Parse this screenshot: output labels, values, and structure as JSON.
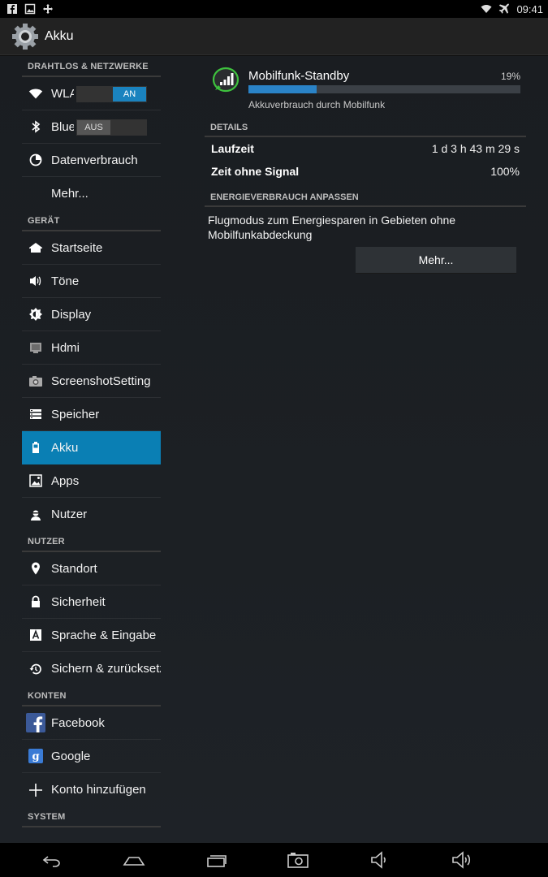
{
  "statusbar": {
    "left_icons": [
      "facebook-notification-icon",
      "image-notification-icon",
      "move-notification-icon"
    ],
    "right_icons": [
      "wifi-icon",
      "airplane-mode-icon"
    ],
    "time": "09:41"
  },
  "actionbar": {
    "title": "Akku",
    "icon": "settings-gear-icon"
  },
  "sidebar": {
    "sections": [
      {
        "header": "DRAHTLOS & NETZWERKE"
      },
      {
        "header": "GERÄT"
      },
      {
        "header": "NUTZER"
      },
      {
        "header": "KONTEN"
      },
      {
        "header": "SYSTEM"
      }
    ],
    "wifi": {
      "label": "WLAN",
      "toggle": "AN"
    },
    "bluetooth": {
      "label": "Bluetooth",
      "toggle": "AUS"
    },
    "items": {
      "data_usage": "Datenverbrauch",
      "more": "Mehr...",
      "home": "Startseite",
      "sounds": "Töne",
      "display": "Display",
      "hdmi": "Hdmi",
      "screenshot": "ScreenshotSetting",
      "storage": "Speicher",
      "battery": "Akku",
      "apps": "Apps",
      "users": "Nutzer",
      "location": "Standort",
      "security": "Sicherheit",
      "language": "Sprache & Eingabe",
      "backup": "Sichern & zurücksetzen",
      "facebook": "Facebook",
      "google": "Google",
      "add_account": "Konto hinzufügen"
    },
    "active": "battery"
  },
  "detail": {
    "usage_name": "Mobilfunk-Standby",
    "usage_percent_label": "19%",
    "usage_percent": 0.25,
    "usage_sub": "Akkuverbrauch durch Mobilfunk",
    "details_header": "DETAILS",
    "rows": [
      {
        "key": "Laufzeit",
        "value": "1 d 3 h 43 m 29 s"
      },
      {
        "key": "Zeit ohne Signal",
        "value": "100%"
      }
    ],
    "energy_header": "ENERGIEVERBRAUCH ANPASSEN",
    "energy_text": "Flugmodus zum Energiesparen in Gebieten ohne Mobilfunkabdeckung",
    "more_button": "Mehr..."
  },
  "navbar": {
    "icons": [
      "back-icon",
      "home-icon",
      "recent-apps-icon",
      "screenshot-icon",
      "volume-down-icon",
      "volume-up-icon"
    ]
  },
  "colors": {
    "accent": "#0a7fb4",
    "toggle_on": "#1a83bf",
    "progress": "#2a83c7"
  }
}
